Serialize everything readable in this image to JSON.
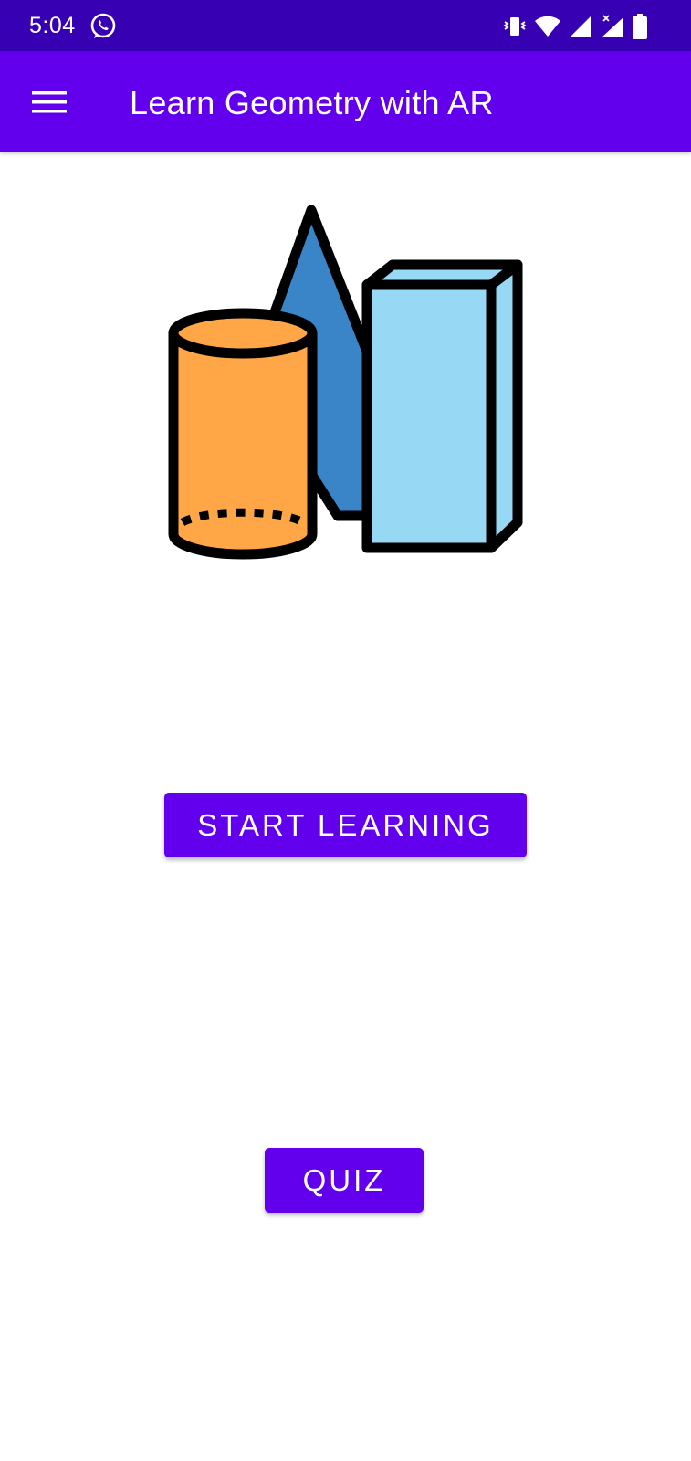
{
  "status_bar": {
    "time": "5:04",
    "left_icons": [
      "whatsapp-icon"
    ],
    "right_icons": [
      "vibrate-icon",
      "wifi-icon",
      "signal-icon",
      "signal-no-data-icon",
      "battery-icon"
    ],
    "background": "#3700b3"
  },
  "app_bar": {
    "title": "Learn Geometry with AR",
    "menu_icon": "hamburger-menu-icon",
    "background": "#6200ee"
  },
  "illustration": {
    "description_icon": "geometry-shapes-icon",
    "colors": {
      "cylinder": "#ffa746",
      "cone": "#3a85c8",
      "prism_front": "#97d8f5",
      "outline": "#000000"
    }
  },
  "buttons": {
    "start_learning": "START LEARNING",
    "quiz": "QUIZ",
    "color": "#6200ee"
  }
}
